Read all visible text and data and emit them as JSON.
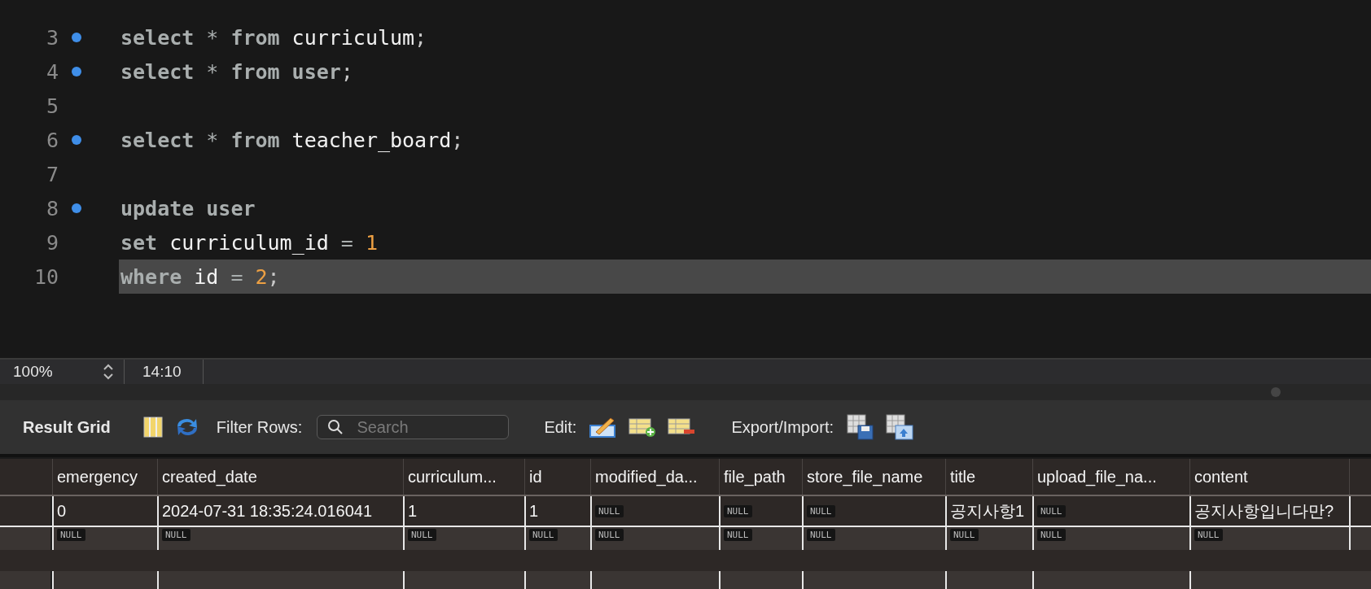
{
  "editor": {
    "lines": [
      {
        "number": "3",
        "statement_marker": true,
        "current": false,
        "tokens": [
          {
            "kind": "keyword",
            "text": "select"
          },
          {
            "kind": "op",
            "text": "*"
          },
          {
            "kind": "keyword",
            "text": "from"
          },
          {
            "kind": "ident",
            "text": "curriculum"
          },
          {
            "kind": "punct",
            "text": ";"
          }
        ]
      },
      {
        "number": "4",
        "statement_marker": true,
        "current": false,
        "tokens": [
          {
            "kind": "keyword",
            "text": "select"
          },
          {
            "kind": "op",
            "text": "*"
          },
          {
            "kind": "keyword",
            "text": "from"
          },
          {
            "kind": "keyword",
            "text": "user"
          },
          {
            "kind": "punct",
            "text": ";"
          }
        ]
      },
      {
        "number": "5",
        "statement_marker": false,
        "current": false
      },
      {
        "number": "6",
        "statement_marker": true,
        "current": false,
        "tokens": [
          {
            "kind": "keyword",
            "text": "select"
          },
          {
            "kind": "op",
            "text": "*"
          },
          {
            "kind": "keyword",
            "text": "from"
          },
          {
            "kind": "ident",
            "text": "teacher_board"
          },
          {
            "kind": "punct",
            "text": ";"
          }
        ]
      },
      {
        "number": "7",
        "statement_marker": false,
        "current": false
      },
      {
        "number": "8",
        "statement_marker": true,
        "current": false,
        "tokens": [
          {
            "kind": "keyword",
            "text": "update"
          },
          {
            "kind": "keyword",
            "text": "user"
          }
        ]
      },
      {
        "number": "9",
        "statement_marker": false,
        "current": false,
        "tokens": [
          {
            "kind": "keyword",
            "text": "set"
          },
          {
            "kind": "ident",
            "text": "curriculum_id"
          },
          {
            "kind": "op",
            "text": "="
          },
          {
            "kind": "number",
            "text": "1"
          }
        ]
      },
      {
        "number": "10",
        "statement_marker": false,
        "current": true,
        "tokens": [
          {
            "kind": "keyword",
            "text": "where"
          },
          {
            "kind": "ident",
            "text": "id"
          },
          {
            "kind": "op",
            "text": "="
          },
          {
            "kind": "number",
            "text": "2"
          },
          {
            "kind": "punct",
            "text": ";"
          }
        ]
      }
    ]
  },
  "status_bar": {
    "zoom": "100%",
    "position": "14:10"
  },
  "toolbar": {
    "title": "Result Grid",
    "filter_label": "Filter Rows:",
    "search": {
      "placeholder": "Search"
    },
    "edit_label": "Edit:",
    "export_label": "Export/Import:"
  },
  "grid": {
    "columns": [
      "emergency",
      "created_date",
      "curriculum...",
      "id",
      "modified_da...",
      "file_path",
      "store_file_name",
      "title",
      "upload_file_na...",
      "content"
    ],
    "rows": [
      {
        "cells": [
          {
            "kind": "text",
            "text": "0"
          },
          {
            "kind": "text",
            "text": "2024-07-31 18:35:24.016041"
          },
          {
            "kind": "text",
            "text": "1"
          },
          {
            "kind": "text",
            "text": "1"
          },
          {
            "kind": "null",
            "text": "NULL"
          },
          {
            "kind": "null",
            "text": "NULL"
          },
          {
            "kind": "null",
            "text": "NULL"
          },
          {
            "kind": "text",
            "text": "공지사항1"
          },
          {
            "kind": "null",
            "text": "NULL"
          },
          {
            "kind": "text",
            "text": "공지사항입니다만?"
          }
        ]
      },
      {
        "cells": [
          {
            "kind": "null",
            "text": "NULL"
          },
          {
            "kind": "null",
            "text": "NULL"
          },
          {
            "kind": "null",
            "text": "NULL"
          },
          {
            "kind": "null",
            "text": "NULL"
          },
          {
            "kind": "null",
            "text": "NULL"
          },
          {
            "kind": "null",
            "text": "NULL"
          },
          {
            "kind": "null",
            "text": "NULL"
          },
          {
            "kind": "null",
            "text": "NULL"
          },
          {
            "kind": "null",
            "text": "NULL"
          },
          {
            "kind": "null",
            "text": "NULL"
          }
        ]
      }
    ]
  }
}
